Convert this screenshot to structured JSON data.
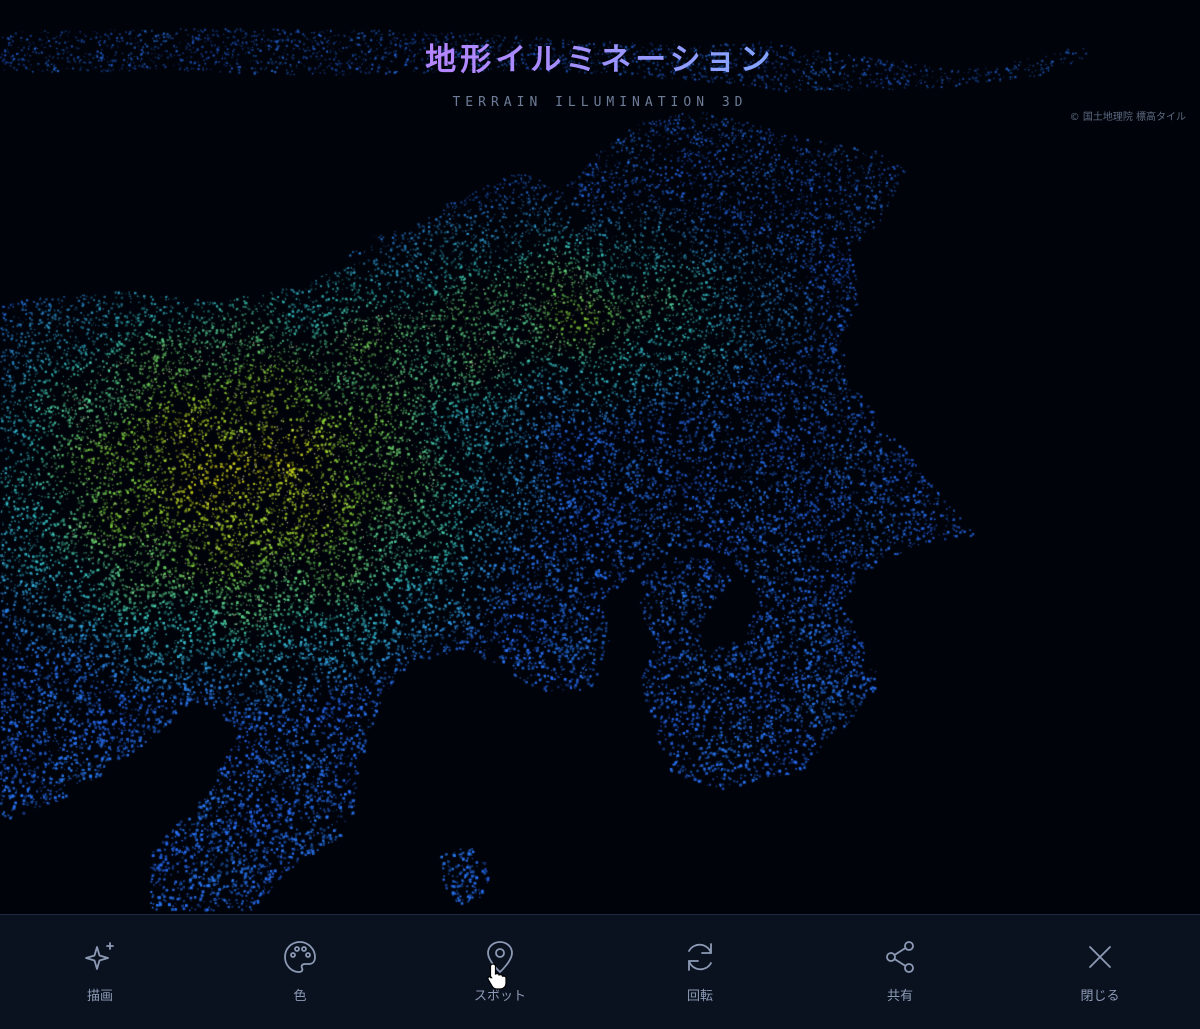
{
  "app": {
    "title": "地形イルミネーション",
    "subtitle": "TERRAIN ILLUMINATION 3D",
    "attribution": "© 国土地理院 標高タイル"
  },
  "colors": {
    "background": "#01030a",
    "toolbar_bg": "#0a1220",
    "icon": "#8d9ab5",
    "low_elevation": "#2e7dff",
    "mid_elevation": "#3fe0d8",
    "high_elevation": "#e8f020"
  },
  "toolbar": {
    "items": [
      {
        "id": "draw",
        "label": "描画",
        "icon": "sparkle-icon"
      },
      {
        "id": "color",
        "label": "色",
        "icon": "palette-icon"
      },
      {
        "id": "spot",
        "label": "スポット",
        "icon": "map-pin-icon"
      },
      {
        "id": "rotate",
        "label": "回転",
        "icon": "rotate-icon"
      },
      {
        "id": "share",
        "label": "共有",
        "icon": "share-icon"
      },
      {
        "id": "close",
        "label": "閉じる",
        "icon": "close-icon"
      }
    ]
  }
}
